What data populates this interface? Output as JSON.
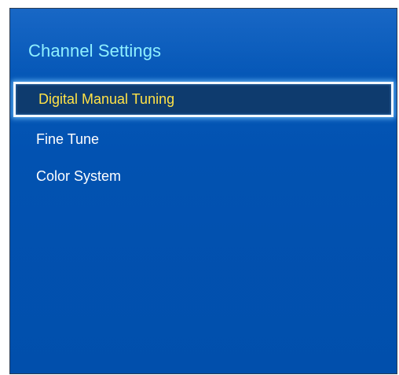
{
  "title": "Channel Settings",
  "menu": {
    "items": [
      {
        "label": "Digital Manual Tuning",
        "selected": true
      },
      {
        "label": "Fine Tune",
        "selected": false
      },
      {
        "label": "Color System",
        "selected": false
      }
    ]
  },
  "colors": {
    "panel_background": "#0252b1",
    "title_text": "#8ff0ff",
    "selected_text": "#ffe146",
    "selected_background": "#0e3b6e",
    "selected_border": "#f4f9ff",
    "item_text": "#ffffff"
  }
}
